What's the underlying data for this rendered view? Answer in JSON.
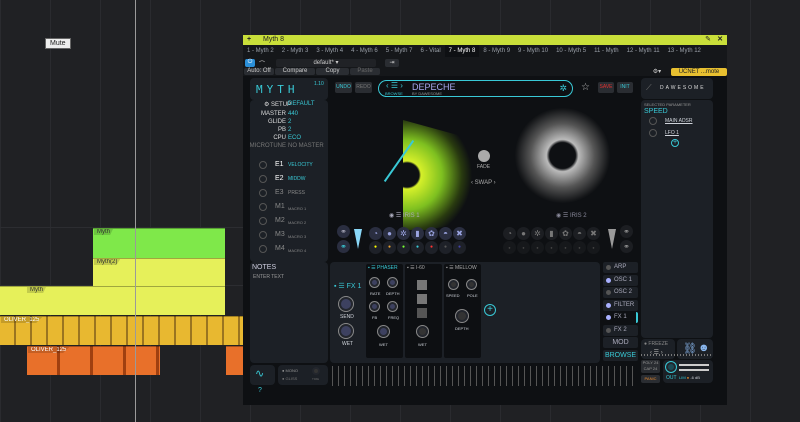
{
  "daw": {
    "tooltip": "Mute",
    "clips": {
      "myth": "Myth",
      "myth2": "Myth(2)",
      "oliver": "OLIVER_125"
    }
  },
  "window": {
    "title": "Myth 8",
    "tabs": [
      "1 - Myth 2",
      "2 - Myth 3",
      "3 - Myth 4",
      "4 - Myth 6",
      "5 - Myth 7",
      "6 - Vital",
      "7 - Myth 8",
      "8 - Myth 9",
      "9 - Myth 10",
      "10 - Myth 5",
      "11 - Myth",
      "12 - Myth 11",
      "13 - Myth 12"
    ],
    "active_tab": 6
  },
  "toolbar": {
    "auto": "Auto: Off",
    "compare": "Compare",
    "copy": "Copy",
    "paste": "Paste",
    "preset": "default*",
    "routing": "UCNET ...mote"
  },
  "plugin": {
    "logo": "MYTH",
    "version": "1.10",
    "undo": "UNDO",
    "redo": "REDO",
    "preset": {
      "browse": "BROWSE",
      "name": "DEPECHE",
      "author": "BY DAWESOME"
    },
    "save": "SAVE",
    "init": "INIT",
    "brand": "DAWESOME",
    "setup": {
      "title": "SETUP",
      "value": "DEFAULT",
      "rows": [
        {
          "k": "MASTER",
          "v": "440"
        },
        {
          "k": "GLIDE",
          "v": "2"
        },
        {
          "k": "PB",
          "v": "2"
        },
        {
          "k": "CPU",
          "v": "ECO"
        },
        {
          "k": "MICROTUNE",
          "v": "NO MASTER"
        }
      ]
    },
    "mods": [
      {
        "k": "E1",
        "v": "VELOCITY"
      },
      {
        "k": "E2",
        "v": "MIDDW"
      },
      {
        "k": "E3",
        "v": "PRESS"
      },
      {
        "k": "M1",
        "v": "MACRO 1"
      },
      {
        "k": "M2",
        "v": "MACRO 2"
      },
      {
        "k": "M3",
        "v": "MACRO 3"
      },
      {
        "k": "M4",
        "v": "MACRO 4"
      }
    ],
    "iris1": "IRIS 1",
    "iris2": "IRIS 2",
    "fade": "FADE",
    "swap": "SWAP",
    "selected": {
      "title": "SELECTED PARAMETER",
      "name": "SPEED",
      "items": [
        "MAIN ADSR",
        "LFO 1"
      ]
    },
    "notes": {
      "title": "NOTES",
      "placeholder": "ENTER TEXT"
    },
    "fx": {
      "title": "FX 1",
      "send": "SEND",
      "wet": "WET",
      "phaser": {
        "title": "PHASER",
        "rate": "RATE",
        "depth": "DEPTH",
        "fb": "FB",
        "freq": "FREQ",
        "wet": "WET"
      },
      "i60": {
        "title": "I-60",
        "wet": "WET"
      },
      "mellow": {
        "title": "MELLOW",
        "speed": "SPEED",
        "pole": "POLE",
        "depth": "DEPTH"
      }
    },
    "side_tabs": [
      "ARP",
      "OSC 1",
      "OSC 2",
      "FILTER",
      "FX 1",
      "FX 2",
      "MOD",
      "BROWSE"
    ],
    "freeze": "FREEZE",
    "mono": "MONO",
    "gliss": "GLISS",
    "time": "TIME",
    "poly": "POLY 24",
    "cap": "CAP 24",
    "panic": "PANIC",
    "out": "OUT",
    "lim": "LIM",
    "db": "-6 dB",
    "help": "?"
  },
  "colors": {
    "accent": "#39c9d6",
    "titlebar": "#c9df3a",
    "green_clip": "#7fe84a",
    "yellow_clip": "#e6f05a",
    "gold_clip": "#e8b830",
    "orange_clip": "#e8702a"
  }
}
